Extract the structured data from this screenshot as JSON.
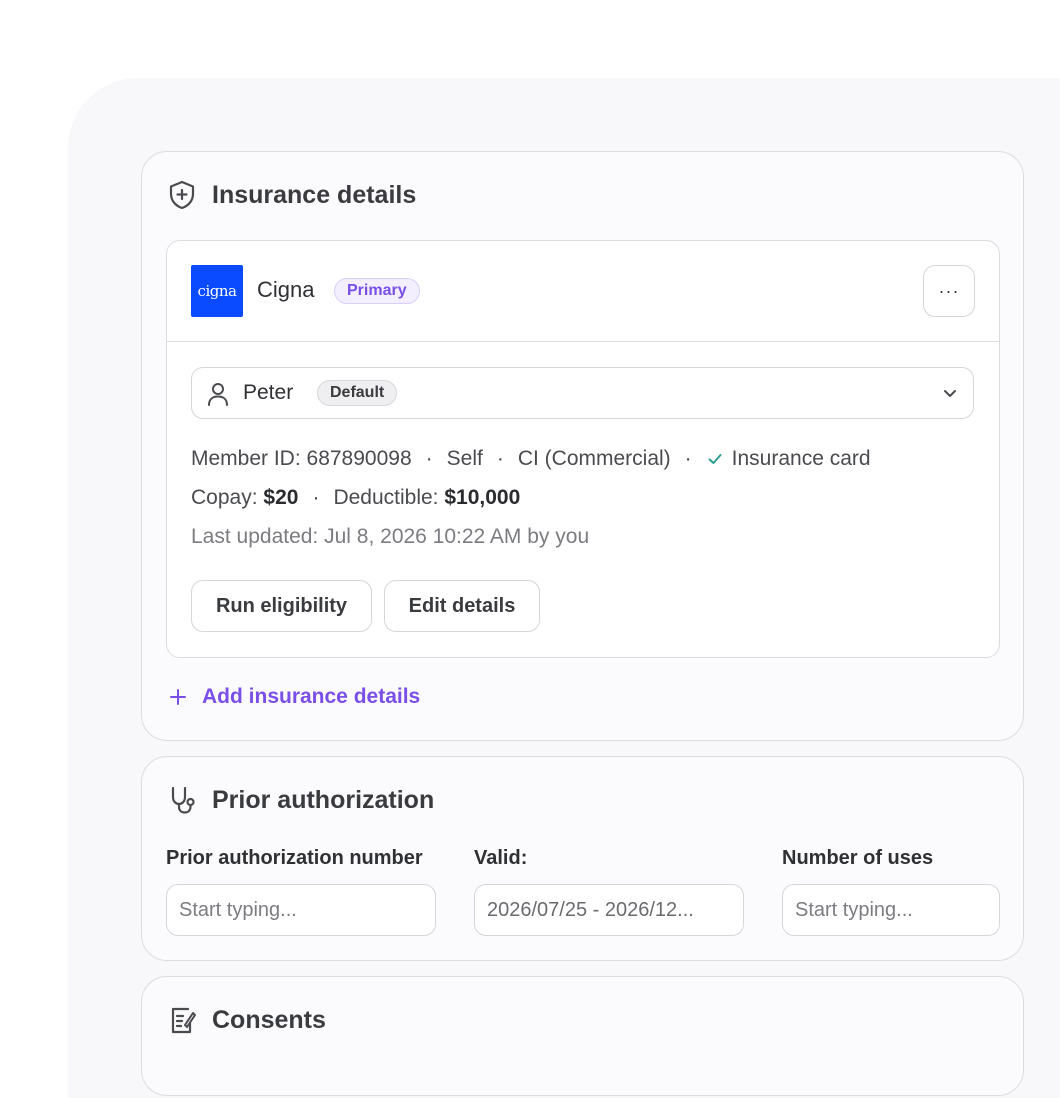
{
  "insurance": {
    "title": "Insurance details",
    "plan": {
      "carrier": "Cigna",
      "logo_text": "cigna",
      "badge": "Primary",
      "more_label": "···",
      "member": {
        "name": "Peter",
        "badge": "Default"
      },
      "member_id": "Member ID: 687890098",
      "relationship": "Self",
      "plan_type": "CI (Commercial)",
      "card_label": "Insurance card",
      "copay_label": "Copay:",
      "copay_value": "$20",
      "deductible_label": "Deductible:",
      "deductible_value": "$10,000",
      "last_updated": "Last updated: Jul 8, 2026 10:22 AM by you",
      "run_eligibility": "Run eligibility",
      "edit_details": "Edit details"
    },
    "add_label": "Add insurance details"
  },
  "prior_auth": {
    "title": "Prior authorization",
    "number_label": "Prior authorization number",
    "number_placeholder": "Start typing...",
    "valid_label": "Valid:",
    "valid_value": "2026/07/25 - 2026/12...",
    "uses_label": "Number of uses",
    "uses_placeholder": "Start typing..."
  },
  "consents": {
    "title": "Consents"
  },
  "colors": {
    "accent": "#7a4fe8",
    "logo_bg": "#0a4bff",
    "check": "#2a9d8f"
  }
}
